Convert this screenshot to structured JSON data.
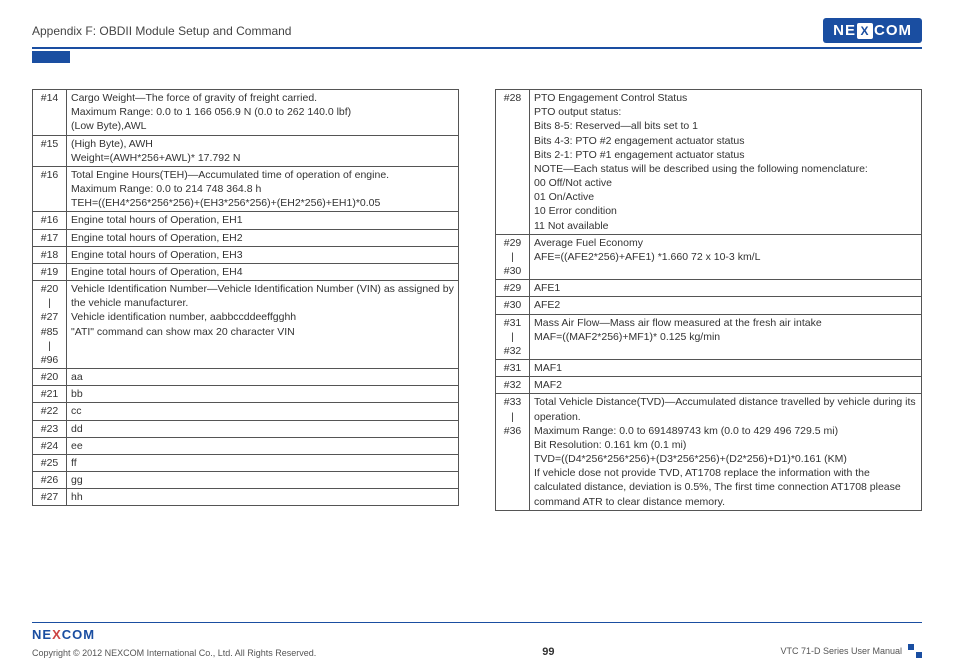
{
  "header": {
    "title": "Appendix F: OBDII Module Setup and Command",
    "brand": "NEXCOM"
  },
  "left_rows": [
    {
      "id": "#14",
      "text": "Cargo Weight—The force of gravity of freight carried.\nMaximum Range: 0.0 to 1 166 056.9 N (0.0 to 262 140.0 lbf)\n(Low Byte),AWL"
    },
    {
      "id": "#15",
      "text": "(High Byte), AWH\nWeight=(AWH*256+AWL)* 17.792 N"
    },
    {
      "id": "#16",
      "text": "Total Engine Hours(TEH)—Accumulated time of operation of engine.\nMaximum Range: 0.0 to 214 748 364.8 h\nTEH=((EH4*256*256*256)+(EH3*256*256)+(EH2*256)+EH1)*0.05"
    },
    {
      "id": "#16",
      "text": "Engine total hours of Operation, EH1"
    },
    {
      "id": "#17",
      "text": "Engine total hours of Operation, EH2"
    },
    {
      "id": "#18",
      "text": "Engine total hours of Operation, EH3"
    },
    {
      "id": "#19",
      "text": "Engine total hours of Operation, EH4"
    },
    {
      "id": "#20\n|\n#27\n#85\n|\n#96",
      "text": "Vehicle Identification Number—Vehicle Identification Number (VIN) as assigned by the vehicle manufacturer.\nVehicle identification number, aabbccddeeffgghh\n\"ATI\" command can show max 20 character VIN"
    },
    {
      "id": "#20",
      "text": "aa"
    },
    {
      "id": "#21",
      "text": "bb"
    },
    {
      "id": "#22",
      "text": "cc"
    },
    {
      "id": "#23",
      "text": "dd"
    },
    {
      "id": "#24",
      "text": "ee"
    },
    {
      "id": "#25",
      "text": "ff"
    },
    {
      "id": "#26",
      "text": "gg"
    },
    {
      "id": "#27",
      "text": "hh"
    }
  ],
  "right_rows": [
    {
      "id": "#28",
      "text": "PTO Engagement Control Status\nPTO output status:\nBits 8-5: Reserved—all bits set to 1\nBits 4-3: PTO #2 engagement actuator status\nBits 2-1: PTO #1 engagement actuator status\nNOTE—Each status will be described using the following nomenclature:\n00 Off/Not active\n01 On/Active\n10 Error condition\n11 Not available"
    },
    {
      "id": "#29\n|\n#30",
      "text": "Average Fuel Economy\nAFE=((AFE2*256)+AFE1) *1.660 72 x 10-3 km/L"
    },
    {
      "id": "#29",
      "text": "AFE1"
    },
    {
      "id": "#30",
      "text": "AFE2"
    },
    {
      "id": "#31\n|\n#32",
      "text": "Mass Air Flow—Mass air flow measured at the fresh air intake\nMAF=((MAF2*256)+MF1)* 0.125 kg/min"
    },
    {
      "id": "#31",
      "text": "MAF1"
    },
    {
      "id": "#32",
      "text": "MAF2"
    },
    {
      "id": "#33\n|\n#36",
      "text": "Total Vehicle Distance(TVD)—Accumulated distance travelled by vehicle during its operation.\nMaximum Range: 0.0 to 691489743 km (0.0 to 429 496 729.5 mi)\nBit Resolution: 0.161 km (0.1 mi)\nTVD=((D4*256*256*256)+(D3*256*256)+(D2*256)+D1)*0.161 (KM)\nIf vehicle dose not provide TVD, AT1708 replace the information with the calculated distance, deviation is 0.5%, The first time connection AT1708 please command ATR to clear distance memory."
    }
  ],
  "footer": {
    "copyright": "Copyright © 2012 NEXCOM International Co., Ltd. All Rights Reserved.",
    "page": "99",
    "manual": "VTC 71-D Series User Manual"
  }
}
